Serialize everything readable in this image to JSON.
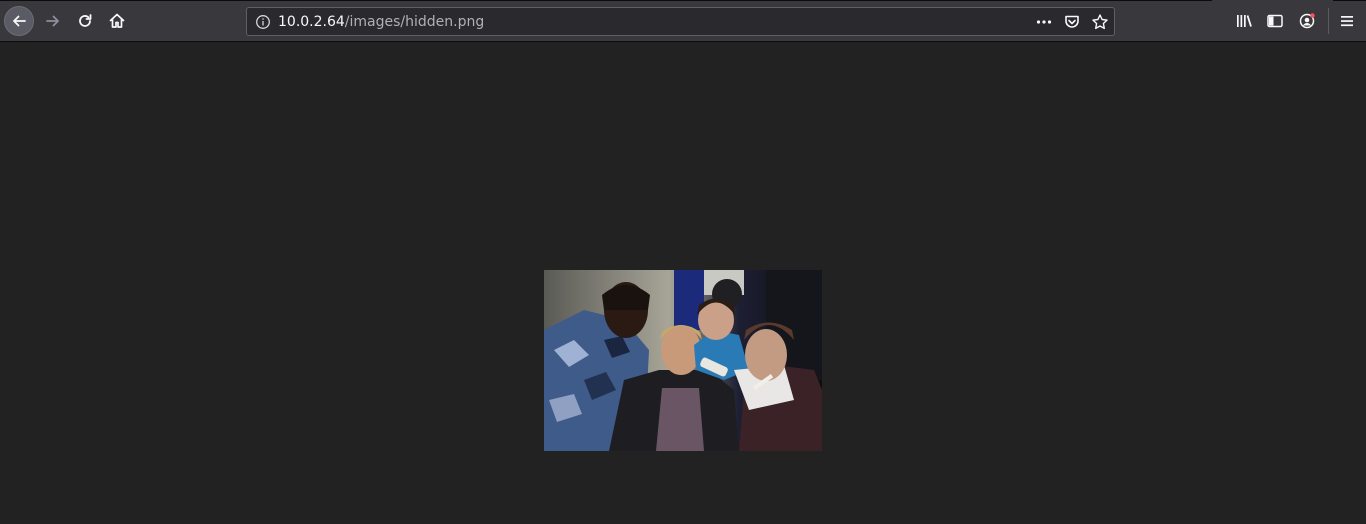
{
  "browser": {
    "url_host": "10.0.2.64",
    "url_path": "/images/hidden.png",
    "icons": {
      "back": "back-arrow-icon",
      "forward": "forward-arrow-icon",
      "reload": "reload-icon",
      "home": "home-icon",
      "info": "info-icon",
      "more": "page-actions-icon",
      "pocket": "pocket-icon",
      "bookmark": "bookmark-star-icon",
      "library": "library-icon",
      "sidebar": "sidebar-icon",
      "account": "account-icon",
      "menu": "hamburger-menu-icon"
    },
    "colors": {
      "toolbar": "#38383d",
      "urlbar": "#2a2a2e",
      "page_background": "#222222"
    }
  },
  "page": {
    "image_description_name": "hidden-png-image"
  }
}
